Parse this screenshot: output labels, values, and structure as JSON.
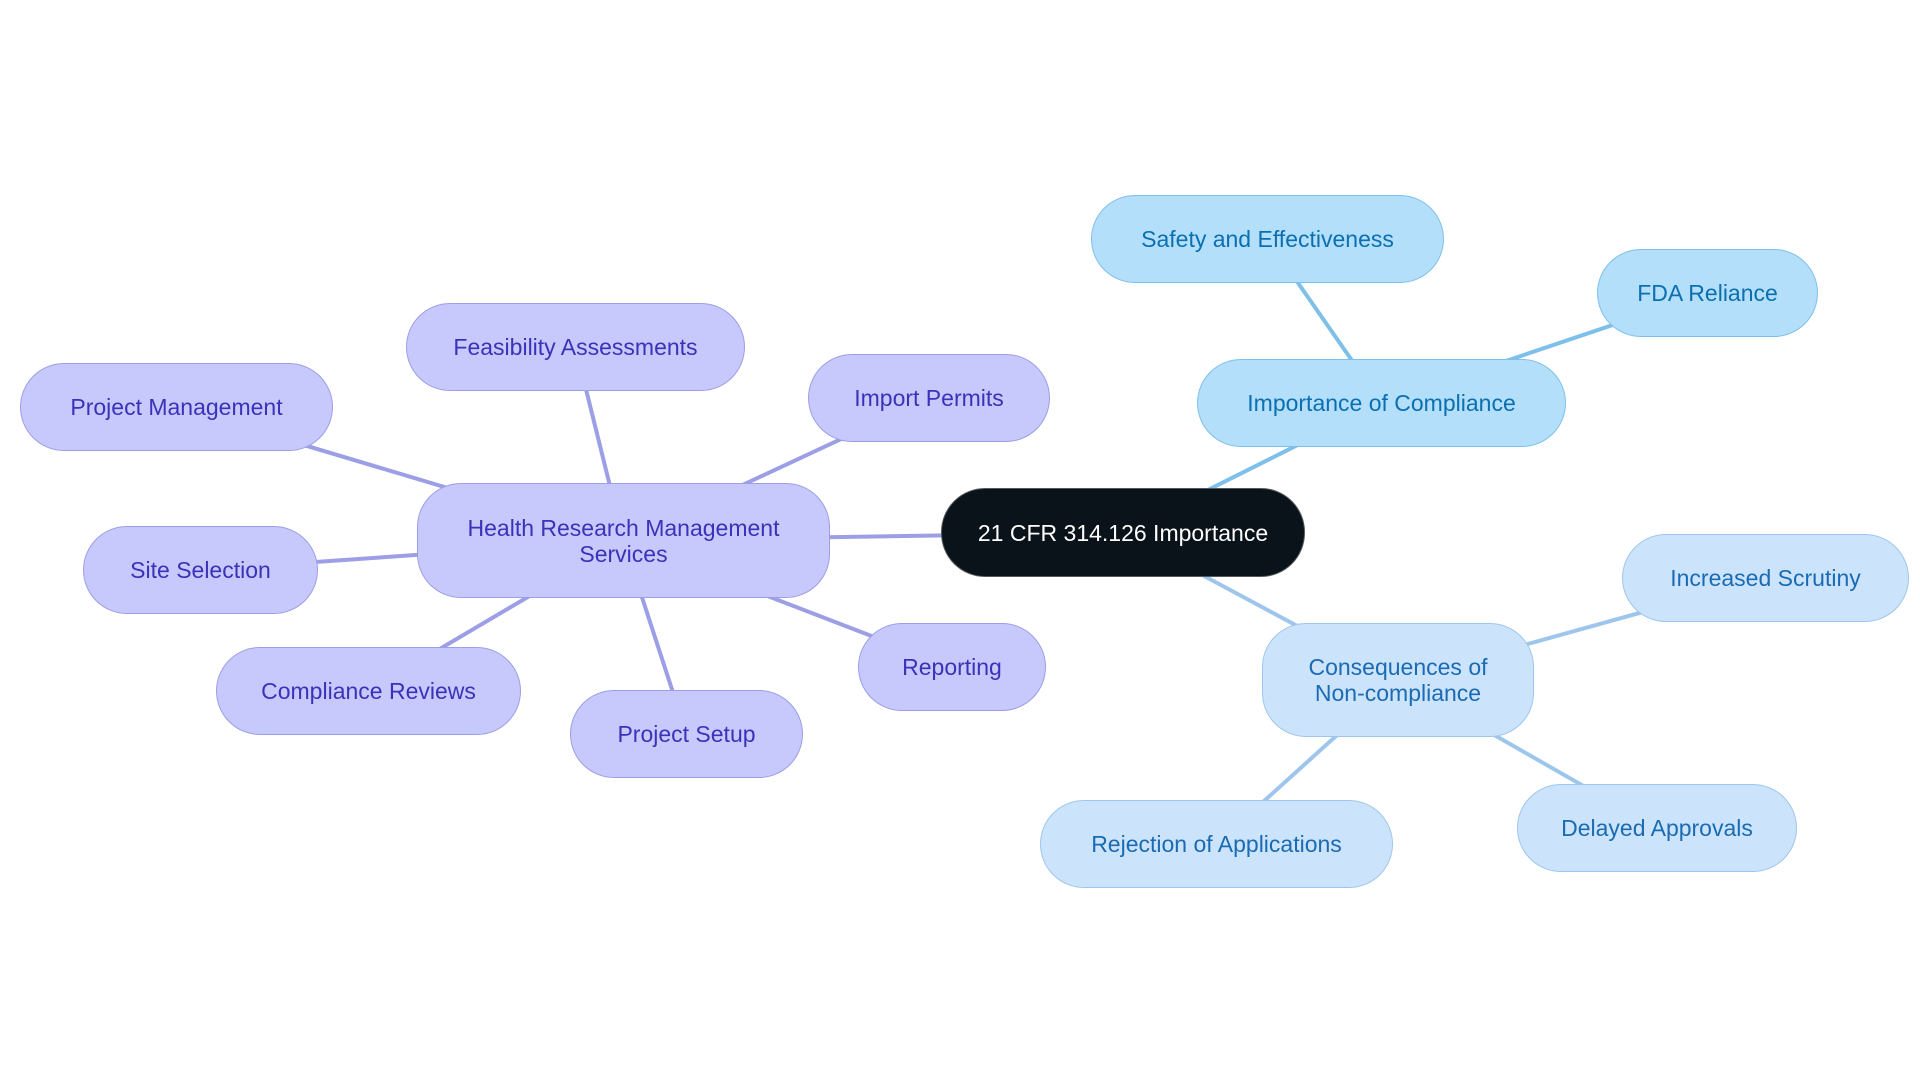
{
  "diagram": {
    "type": "mindmap",
    "root": {
      "id": "root",
      "label": "21 CFR 314.126 Importance"
    },
    "branches": [
      {
        "id": "hrms",
        "label": "Health Research Management Services",
        "style": "purple",
        "children": [
          {
            "id": "feas",
            "label": "Feasibility Assessments"
          },
          {
            "id": "pm",
            "label": "Project Management"
          },
          {
            "id": "import",
            "label": "Import Permits"
          },
          {
            "id": "site",
            "label": "Site Selection"
          },
          {
            "id": "comp",
            "label": "Compliance Reviews"
          },
          {
            "id": "setup",
            "label": "Project Setup"
          },
          {
            "id": "report",
            "label": "Reporting"
          }
        ]
      },
      {
        "id": "ioc",
        "label": "Importance of Compliance",
        "style": "blue1",
        "children": [
          {
            "id": "safety",
            "label": "Safety and Effectiveness"
          },
          {
            "id": "fda",
            "label": "FDA Reliance"
          }
        ]
      },
      {
        "id": "con",
        "label": "Consequences of Non-compliance",
        "style": "blue2",
        "children": [
          {
            "id": "scrutiny",
            "label": "Increased Scrutiny"
          },
          {
            "id": "delayed",
            "label": "Delayed Approvals"
          },
          {
            "id": "reject",
            "label": "Rejection of Applications"
          }
        ]
      }
    ],
    "colors": {
      "root_fill": "#0b131a",
      "purple_fill": "#c7c9fd",
      "purple_text": "#3a32b8",
      "purple_edge": "#9c9ee6",
      "blue1_fill": "#b3dffb",
      "blue1_text": "#0b6fb0",
      "blue1_edge": "#7ec0ea",
      "blue2_fill": "#cce4fb",
      "blue2_text": "#1a6bb4",
      "blue2_edge": "#9ec6ec"
    }
  }
}
